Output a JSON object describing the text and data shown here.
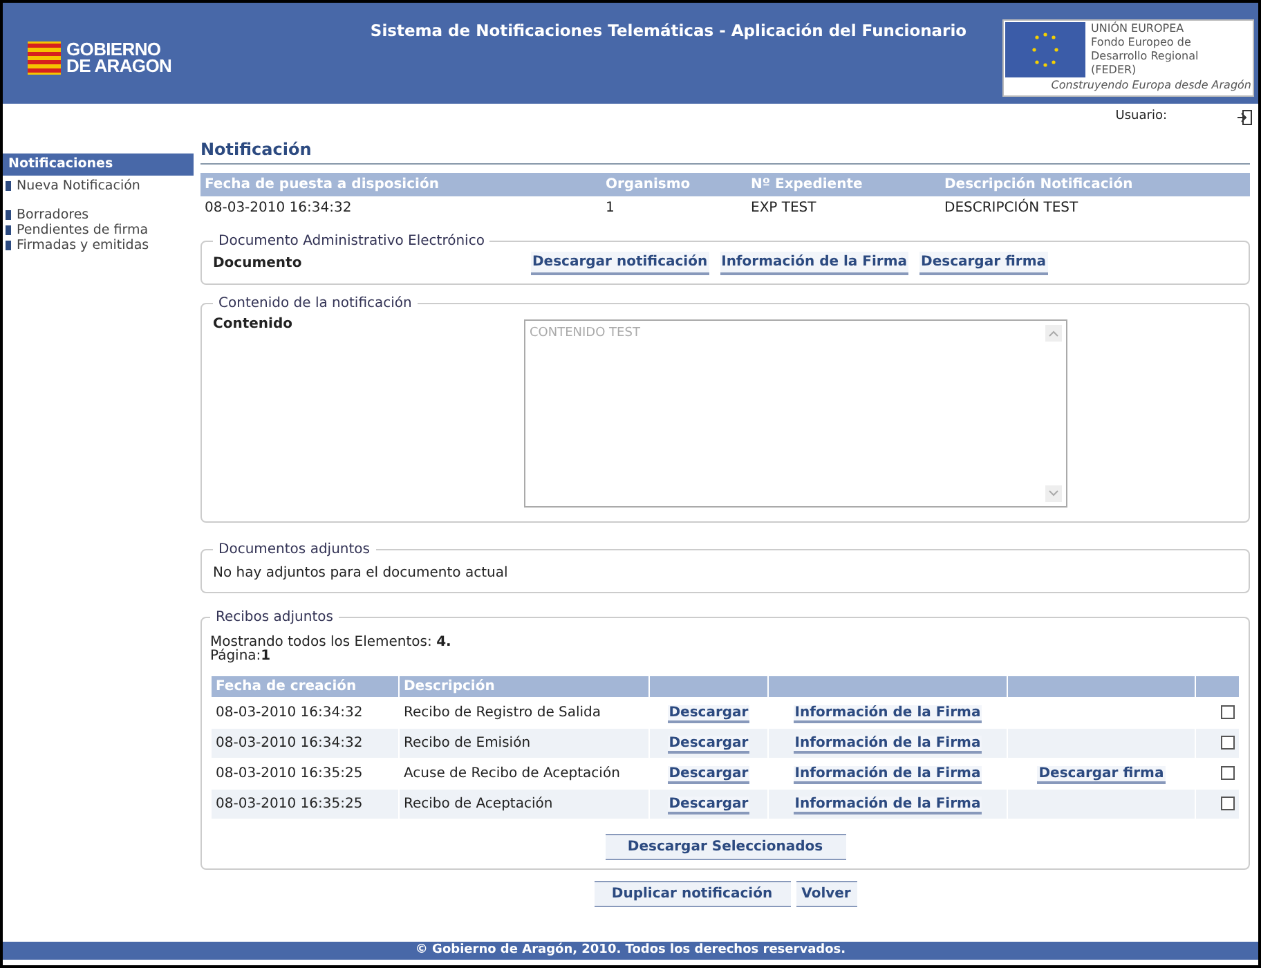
{
  "header": {
    "logo_lines": [
      "GOBIERNO",
      "DE ARAGON"
    ],
    "title": "Sistema de Notificaciones Telemáticas - Aplicación del Funcionario",
    "eu_lines": [
      "UNIÓN EUROPEA",
      "Fondo Europeo de",
      "Desarrollo Regional",
      "(FEDER)"
    ],
    "eu_slogan": "Construyendo Europa desde Aragón"
  },
  "user_label": "Usuario:",
  "sidebar": {
    "heading": "Notificaciones",
    "groups": [
      [
        "Nueva Notificación"
      ],
      [
        "Borradores",
        "Pendientes de firma",
        "Firmadas y emitidas"
      ]
    ]
  },
  "notification": {
    "title": "Notificación",
    "columns": [
      "Fecha de puesta a disposición",
      "Organismo",
      "Nº Expediente",
      "Descripción Notificación"
    ],
    "row": [
      "08-03-2010 16:34:32",
      "1",
      "EXP TEST",
      "DESCRIPCIÓN TEST"
    ]
  },
  "document_section": {
    "legend": "Documento Administrativo Electrónico",
    "label": "Documento",
    "links": [
      "Descargar notificación",
      "Información de la Firma",
      "Descargar firma"
    ]
  },
  "content_section": {
    "legend": "Contenido de la notificación",
    "label": "Contenido",
    "value": "CONTENIDO TEST"
  },
  "attachments_section": {
    "legend": "Documentos adjuntos",
    "message": "No hay adjuntos para el documento actual"
  },
  "receipts_section": {
    "legend": "Recibos adjuntos",
    "summary": "Mostrando todos los Elementos: **4.**",
    "page": "Página:**1**",
    "columns": [
      "Fecha de creación",
      "Descripción"
    ],
    "rows": [
      {
        "date": "08-03-2010 16:34:32",
        "description": "Recibo de Registro de Salida",
        "download": "Descargar",
        "signature_info": "Información de la Firma",
        "checked": false
      },
      {
        "date": "08-03-2010 16:34:32",
        "description": "Recibo de Emisión",
        "download": "Descargar",
        "signature_info": "Información de la Firma",
        "checked": false
      },
      {
        "date": "08-03-2010 16:35:25",
        "description": "Acuse de Recibo de Aceptación",
        "download": "Descargar",
        "signature_info": "Información de la Firma",
        "download_signature": "Descargar firma",
        "checked": false
      },
      {
        "date": "08-03-2010 16:35:25",
        "description": "Recibo de Aceptación",
        "download": "Descargar",
        "signature_info": "Información de la Firma",
        "checked": false
      }
    ],
    "download_selected": "Descargar Seleccionados"
  },
  "actions": [
    "Duplicar notificación",
    "Volver"
  ],
  "footer": "© Gobierno de Aragón, 2010. Todos los derechos reservados."
}
